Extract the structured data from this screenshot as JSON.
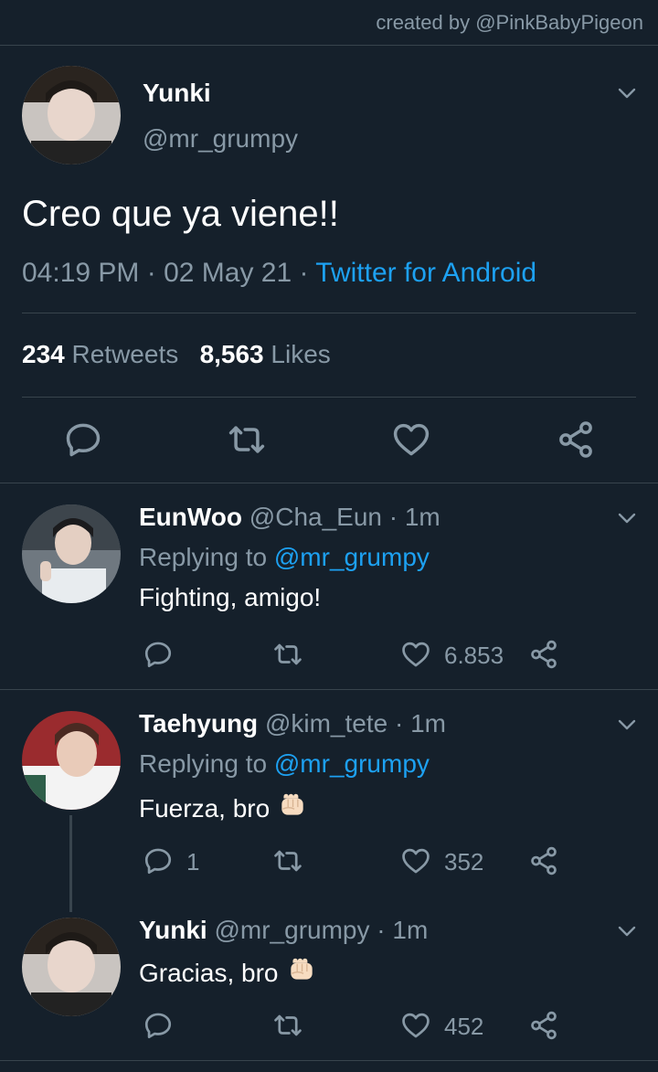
{
  "credit": "created by @PinkBabyPigeon",
  "main_tweet": {
    "name": "Yunki",
    "handle": "@mr_grumpy",
    "text": "Creo que ya viene!!",
    "time": "04:19 PM · 02 May 21 · ",
    "source": "Twitter for Android",
    "retweets": "234",
    "retweets_label": "Retweets",
    "likes": "8,563",
    "likes_label": "Likes"
  },
  "replies": [
    {
      "name": "EunWoo",
      "handle_time": "@Cha_Eun · 1m",
      "replying_prefix": "Replying to ",
      "replying_to": "@mr_grumpy",
      "text": "Fighting, amigo!",
      "reply_count": "",
      "like_count": "6.853"
    },
    {
      "name": "Taehyung",
      "handle_time": "@kim_tete · 1m",
      "replying_prefix": "Replying to ",
      "replying_to": "@mr_grumpy",
      "text": "Fuerza, bro",
      "reply_count": "1",
      "like_count": "352"
    },
    {
      "name": "Yunki",
      "handle_time": "@mr_grumpy · 1m",
      "text": "Gracias, bro",
      "reply_count": "",
      "like_count": "452"
    }
  ],
  "colors": {
    "background": "#15202b",
    "muted": "#8899a6",
    "link": "#1da1f2",
    "divider": "#38444d"
  },
  "icons": [
    "chevron-down-icon",
    "reply-icon",
    "retweet-icon",
    "like-icon",
    "share-icon",
    "fist-emoji"
  ]
}
